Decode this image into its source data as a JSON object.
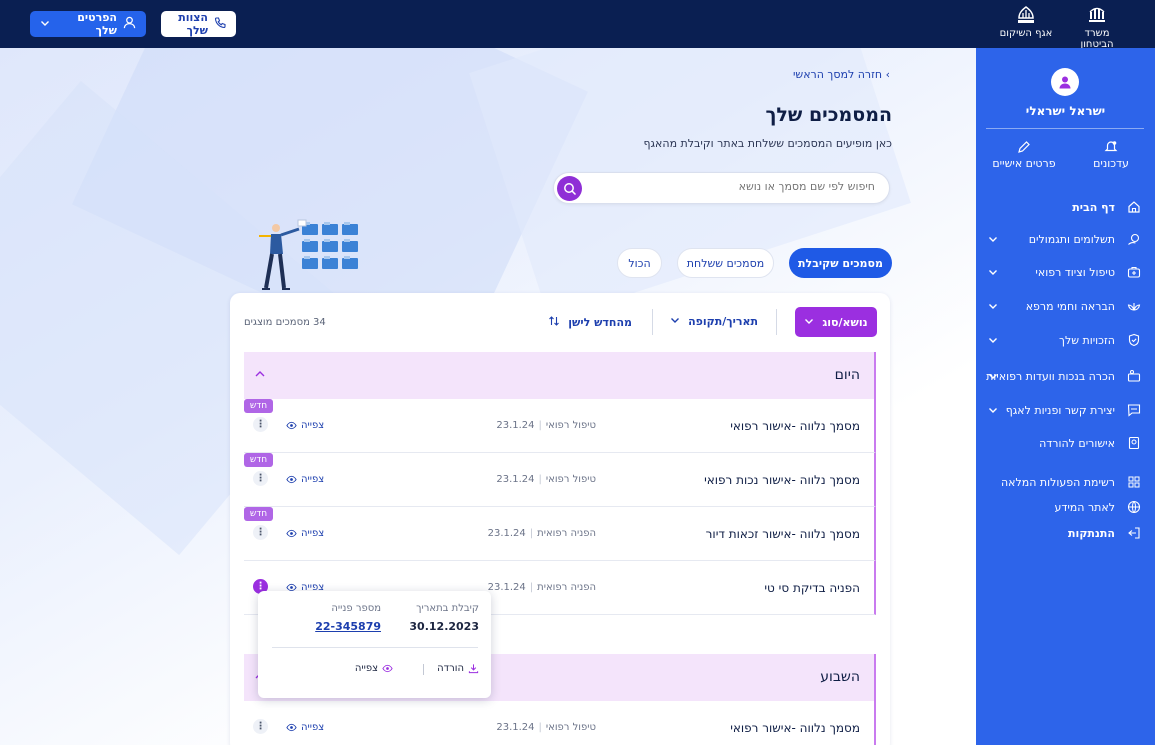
{
  "topbar": {
    "profile_button": "הפרטים שלך",
    "team_button": "הצוות שלך",
    "logo_ministry": "משרד הביטחון",
    "logo_rehab": "אגף השיקום"
  },
  "sidebar": {
    "user_name": "ישראל ישראלי",
    "quick_updates": "עדכונים",
    "quick_details": "פרטים אישיים",
    "items": [
      {
        "label": "דף הבית",
        "icon": "home-icon"
      },
      {
        "label": "תשלומים ותגמולים",
        "icon": "payments-icon"
      },
      {
        "label": "טיפול וציוד רפואי",
        "icon": "medical-kit-icon"
      },
      {
        "label": "הבראה וחמי מרפא",
        "icon": "spa-icon"
      },
      {
        "label": "הזכויות שלך",
        "icon": "shield-icon"
      },
      {
        "label": "הכרה בנכות וועדות רפואיות",
        "icon": "committee-icon"
      },
      {
        "label": "יצירת קשר ופניות לאגף",
        "icon": "chat-icon"
      },
      {
        "label": "אישורים להורדה",
        "icon": "certificate-icon"
      },
      {
        "label": "רשימת הפעולות המלאה",
        "icon": "grid-icon"
      },
      {
        "label": "לאתר המידע",
        "icon": "globe-icon"
      },
      {
        "label": "התנתקות",
        "icon": "logout-icon"
      }
    ]
  },
  "main": {
    "back_link": "חזרה למסך הראשי",
    "title": "המסמכים שלך",
    "subtitle": "כאן מופיעים המסמכים ששלחת באתר וקיבלת מהאגף",
    "search_placeholder": "חיפוש לפי שם מסמך או נושא",
    "tabs": {
      "received": "מסמכים שקיבלת",
      "sent": "מסמכים ששלחת",
      "all": "הכול"
    },
    "filters": {
      "type": "נושא/סוג",
      "date": "תאריך/תקופה",
      "sort": "מהחדש לישן"
    },
    "count": "34 מסמכים מוצגים",
    "view_label": "צפייה",
    "new_badge": "חדש"
  },
  "groups": [
    {
      "label": "היום",
      "rows": [
        {
          "title": "מסמך נלווה -אישור רפואי",
          "category": "טיפול רפואי",
          "date": "23.1.24",
          "is_new": true
        },
        {
          "title": "מסמך נלווה -אישור נכות רפואי",
          "category": "טיפול רפואי",
          "date": "23.1.24",
          "is_new": true
        },
        {
          "title": "מסמך נלווה -אישור זכאות דיור",
          "category": "הפניה רפואית",
          "date": "23.1.24",
          "is_new": true
        },
        {
          "title": "הפניה בדיקת סי טי",
          "category": "הפניה רפואית",
          "date": "23.1.24",
          "is_new": false
        }
      ]
    },
    {
      "label": "השבוע",
      "rows": [
        {
          "title": "מסמך נלווה -אישור רפואי",
          "category": "טיפול רפואי",
          "date": "23.1.24",
          "is_new": false
        }
      ]
    }
  ],
  "popover": {
    "received_label": "קיבלת בתאריך",
    "received_value": "30.12.2023",
    "request_label": "מספר פנייה",
    "request_value": "22-345879",
    "download": "הורדה",
    "view": "צפייה"
  },
  "colors": {
    "topbar": "#0a1f52",
    "sidebar": "#2d64ea",
    "accent_purple": "#9b2fe0",
    "primary_blue": "#1f5ae6"
  }
}
